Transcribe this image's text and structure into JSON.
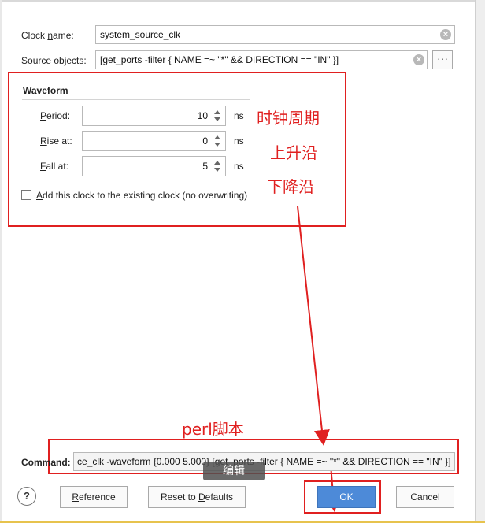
{
  "form": {
    "clock_name": {
      "label_pre": "Clock ",
      "label_key": "n",
      "label_post": "ame:",
      "value": "system_source_clk"
    },
    "source_objects": {
      "label_key": "S",
      "label_post": "ource objects:",
      "value": "[get_ports -filter { NAME =~  \"*\" && DIRECTION == \"IN\" }]",
      "more_label": "···"
    }
  },
  "waveform": {
    "title": "Waveform",
    "unit": "ns",
    "period": {
      "label_key": "P",
      "label_post": "eriod:",
      "value": "10"
    },
    "rise": {
      "label_key": "R",
      "label_post": "ise at:",
      "value": "0"
    },
    "fall": {
      "label_key": "F",
      "label_post": "all at:",
      "value": "5"
    },
    "add_clock_checkbox": {
      "label_key": "A",
      "label_post": "dd this clock to the existing clock (no overwriting)",
      "checked": false
    }
  },
  "annotations": {
    "period": "时钟周期",
    "rise": "上升沿",
    "fall": "下降沿",
    "command": "perl脚本",
    "edit_tip": "编辑",
    "color": "#e02020"
  },
  "command": {
    "label": "Command:",
    "value": "ce_clk -waveform {0.000 5.000} [get_ports -filter { NAME =~  \"*\" && DIRECTION == \"IN\" }]"
  },
  "buttons": {
    "help": "?",
    "reference": {
      "pre": "",
      "key": "R",
      "post": "eference"
    },
    "reset": {
      "pre": "Reset to ",
      "key": "D",
      "post": "efaults"
    },
    "ok": "OK",
    "cancel": "Cancel",
    "ok_color": "#4d8ad8"
  }
}
